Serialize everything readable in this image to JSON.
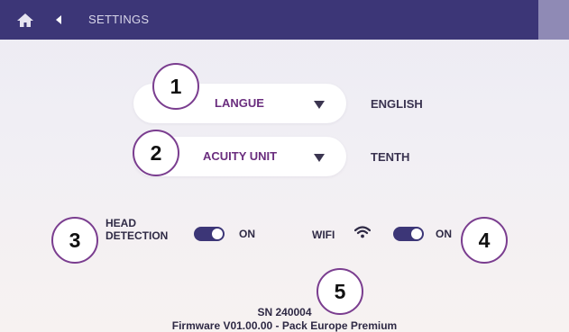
{
  "header": {
    "home_icon": "home-icon",
    "back_icon": "back-arrow-icon",
    "title": "SETTINGS"
  },
  "settings": {
    "language": {
      "label": "LANGUE",
      "value": "ENGLISH",
      "badge": "1"
    },
    "acuity": {
      "label": "ACUITY UNIT",
      "value": "TENTH",
      "badge": "2"
    }
  },
  "head_detection": {
    "label_line1": "HEAD",
    "label_line2": "DETECTION",
    "state": "ON",
    "badge": "3"
  },
  "wifi": {
    "label": "WIFI",
    "icon": "wifi-icon",
    "state": "ON",
    "badge": "4"
  },
  "device": {
    "serial": "SN 240004",
    "firmware": "Firmware V01.00.00 - Pack Europe Premium",
    "badge": "5"
  },
  "colors": {
    "header_bg": "#3c3677",
    "accent_purple": "#6a2d7e",
    "badge_border": "#7a3d8f"
  }
}
